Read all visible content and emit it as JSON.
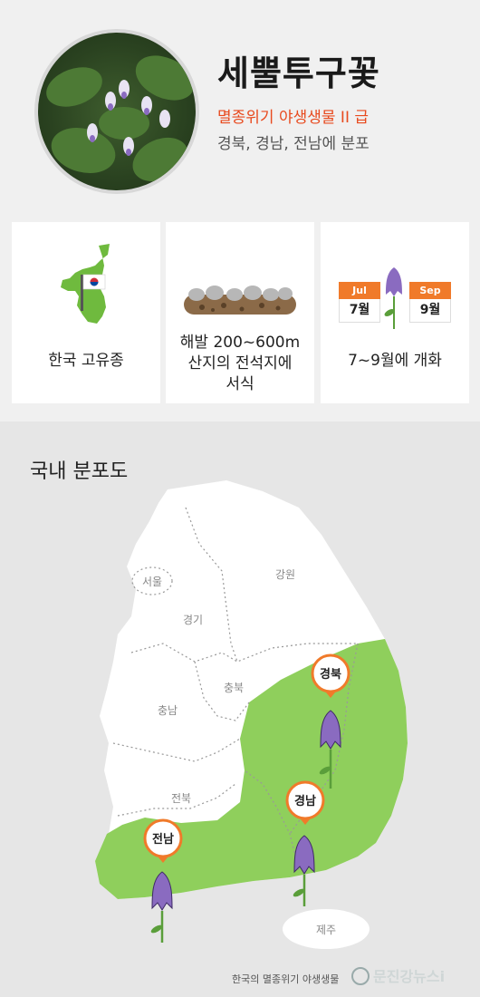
{
  "header": {
    "title": "세뿔투구꽃",
    "status": "멸종위기 야생생물 II 급",
    "distribution": "경북, 경남, 전남에 분포"
  },
  "cards": [
    {
      "label": "한국 고유종"
    },
    {
      "label_lines": [
        "해발 200~600m",
        "산지의 전석지에",
        "서식"
      ]
    },
    {
      "label": "7~9월에 개화",
      "start": {
        "month_en": "Jul",
        "month_ko": "7월"
      },
      "end": {
        "month_en": "Sep",
        "month_ko": "9월"
      }
    }
  ],
  "map": {
    "title": "국내 분포도",
    "regions": [
      "서울",
      "경기",
      "강원",
      "충남",
      "충북",
      "전북",
      "제주"
    ],
    "pins": [
      "경북",
      "경남",
      "전남"
    ]
  },
  "colors": {
    "accent": "#e84a1e",
    "green": "#8fcf5c",
    "pin": "#f07a2a",
    "flower": "#7b5bb8"
  },
  "footer": {
    "credit": "한국의 멸종위기 야생생물",
    "logo": "문진강뉴스i"
  }
}
